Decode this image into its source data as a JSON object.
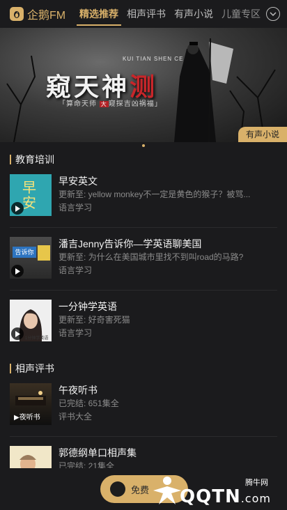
{
  "app": {
    "logo_text": "企鹅FM"
  },
  "tabs": [
    {
      "label": "精选推荐",
      "active": true
    },
    {
      "label": "相声评书",
      "active": false
    },
    {
      "label": "有声小说",
      "active": false
    },
    {
      "label": "儿童专区",
      "active": false
    }
  ],
  "banner": {
    "title_a": "窥天神",
    "title_b": "测",
    "pinyin": "KUI TIAN SHEN CE",
    "subtitle_a": "「算命天师",
    "subtitle_tag": "大",
    "subtitle_b": "窥探吉凶祸福」",
    "badge": "有声小说",
    "page_count": 1,
    "current_page": 1
  },
  "sections": [
    {
      "title": "教育培训",
      "items": [
        {
          "name": "早安英文",
          "update": "更新至: yellow monkey不一定是黄色的猴子？被骂...",
          "category": "语言学习",
          "cover_text": "早安"
        },
        {
          "name": "潘吉Jenny告诉你—学英语聊美国",
          "update": "更新至: 为什么在美国城市里找不到叫road的马路?",
          "category": "语言学习",
          "cover_text": "告诉你"
        },
        {
          "name": "一分钟学英语",
          "update": "更新至: 好奇害死猫",
          "category": "语言学习",
          "cover_text": "1分钟学英语"
        }
      ]
    },
    {
      "title": "相声评书",
      "items": [
        {
          "name": "午夜听书",
          "update": "已完结: 651集全",
          "category": "评书大全",
          "cover_text": "▶夜听书"
        },
        {
          "name": "郭德纲单口相声集",
          "update": "已完结: 21集全",
          "category": "",
          "cover_text": ""
        }
      ]
    }
  ],
  "float_button": {
    "label": "免费"
  },
  "watermark": {
    "text": "QQTN",
    "domain": ".com",
    "site": "腾牛网"
  },
  "colors": {
    "accent": "#d9b16a",
    "background": "#1b1b1d",
    "muted_text": "#8b8b8b"
  }
}
